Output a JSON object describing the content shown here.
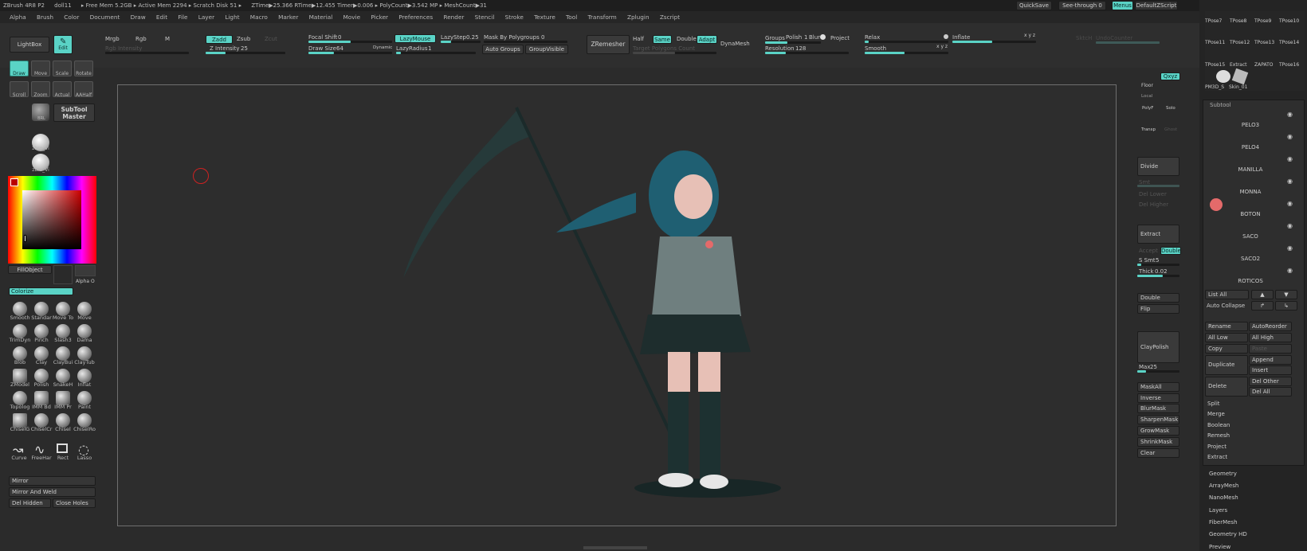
{
  "titlebar": {
    "items": [
      "ZBrush 4R8 P2",
      "doll11",
      "▸ Free Mem 5.2GB ▸ Active Mem 2294 ▸ Scratch Disk 51 ▸",
      "ZTime▶25.366 RTime▶12.455 Timer▶0.006 ▸ PolyCount▶3.542 MP ▸ MeshCount▶31"
    ],
    "quicksave": "QuickSave",
    "seethrough": "See-through",
    "seethrough_value": "0",
    "menus": "Menus",
    "defaultzscript": "DefaultZScript"
  },
  "menubar": [
    "Alpha",
    "Brush",
    "Color",
    "Document",
    "Draw",
    "Edit",
    "File",
    "Layer",
    "Light",
    "Macro",
    "Marker",
    "Material",
    "Movie",
    "Picker",
    "Preferences",
    "Render",
    "Stencil",
    "Stroke",
    "Texture",
    "Tool",
    "Transform",
    "Zplugin",
    "Zscript"
  ],
  "topshelf": {
    "lightbox": "LightBox",
    "edit": "Edit",
    "mrgb": "Mrgb",
    "rgb": "Rgb",
    "m": "M",
    "rgb_intensity": "Rgb Intensity",
    "zadd": "Zadd",
    "zsub": "Zsub",
    "zcut": "Zcut",
    "z_intensity_label": "Z Intensity",
    "z_intensity_value": "25",
    "focal_shift_label": "Focal Shift",
    "focal_shift_value": "0",
    "draw_size_label": "Draw Size",
    "draw_size_value": "64",
    "dynamic": "Dynamic",
    "lazymouse": "LazyMouse",
    "lazystep_label": "LazyStep",
    "lazystep_value": "0.25",
    "lazyradius_label": "LazyRadius",
    "lazyradius_value": "1",
    "mask_by_polygroups_label": "Mask By Polygroups",
    "mask_by_polygroups_value": "0",
    "auto_groups": "Auto Groups",
    "groupvisible": "GroupVisible",
    "zremesher": "ZRemesher",
    "half": "Half",
    "same": "Same",
    "double": "Double",
    "adapt": "Adapt",
    "target_polygons_count": "Target Polygons Count",
    "dynamesh": "DynaMesh",
    "groups": "Groups",
    "polish_label": "Polish",
    "polish_value": "1",
    "blur": "Blur",
    "project": "Project",
    "resolution_label": "Resolution",
    "resolution_value": "128",
    "relax": "Relax",
    "inflate": "Inflate",
    "smooth": "Smooth",
    "sketch": "SktcH",
    "undocounter": "UndoCounter"
  },
  "leftpanel": {
    "tools": [
      {
        "label": "Draw",
        "active": true
      },
      {
        "label": "Move"
      },
      {
        "label": "Scale"
      },
      {
        "label": "Rotate"
      },
      {
        "label": "Scroll"
      },
      {
        "label": "Zoom"
      },
      {
        "label": "Actual"
      },
      {
        "label": "AAHalf"
      }
    ],
    "brl": "BRL",
    "subtool_master": "SubTool Master",
    "material_labels": [
      "zbro_Vi",
      "zbro_Vi"
    ],
    "fill_object": "FillObject",
    "alpha_off": "Alpha O",
    "colorize": "Colorize",
    "brushes": [
      "Smooth",
      "Standar",
      "Move To",
      "Move",
      "TrimDyn",
      "Pinch",
      "Slash3",
      "Dama",
      "Blob",
      "Clay",
      "ClayBui",
      "ClayTub",
      "ZModel",
      "Polish",
      "SnakeH",
      "Inflat",
      "Topolog",
      "IMM Bd",
      "IMM Pr",
      "Paint",
      "ChiselG",
      "ChiselCr",
      "Chisel",
      "ChiselRo"
    ],
    "strokes": [
      "Curve",
      "FreeHar",
      "Rect",
      "Lasso"
    ],
    "mirror": "Mirror",
    "mirror_and_weld": "Mirror And Weld",
    "del_hidden": "Del Hidden",
    "close_holes": "Close Holes"
  },
  "rightshelf": {
    "floor": "Floor",
    "xyz": "Qxyz",
    "local": "Local",
    "polyf": "PolyF",
    "solo": "Solo",
    "transp": "Transp",
    "ghost": "Ghost",
    "divide": "Divide",
    "smt": "Smt",
    "del_lower": "Del Lower",
    "del_higher": "Del Higher",
    "extract": "Extract",
    "accept": "Accept",
    "double": "Double",
    "s_smt_label": "S Smt",
    "s_smt_value": "5",
    "thick_label": "Thick",
    "thick_value": "0.02",
    "double2": "Double",
    "flip": "Flip",
    "claypolish": "ClayPolish",
    "max_label": "Max",
    "max_value": "25",
    "mask_buttons": [
      "MaskAll",
      "Inverse",
      "BlurMask",
      "SharpenMask",
      "GrowMask",
      "ShrinkMask",
      "Clear"
    ]
  },
  "tray": {
    "thumb_labels_row1": [
      "TPose7",
      "TPose8",
      "TPose9",
      "TPose10"
    ],
    "thumb_labels_row2": [
      "TPose11",
      "TPose12",
      "TPose13",
      "TPose14"
    ],
    "thumb_labels_row3": [
      "TPose15",
      "Extract",
      "ZAPATO",
      "TPose16"
    ],
    "pm3d": "PM3D_S",
    "skin": "Skin_01",
    "subtool_header": "Subtool",
    "subtools": [
      "PELO3",
      "PELO4",
      "MANILLA",
      "MONNA",
      "BOTON",
      "SACO",
      "SACO2",
      "ROTICOS"
    ],
    "list_all": "List All",
    "auto_collapse": "Auto Collapse",
    "rename": "Rename",
    "autoreorder": "AutoReorder",
    "all_low": "All Low",
    "all_high": "All High",
    "copy": "Copy",
    "paste": "Paste",
    "duplicate": "Duplicate",
    "append": "Append",
    "insert": "Insert",
    "delete": "Delete",
    "del_other": "Del Other",
    "del_all": "Del All",
    "subtool_actions": [
      "Split",
      "Merge",
      "Boolean",
      "Remesh",
      "Project",
      "Extract"
    ],
    "sections": [
      "Geometry",
      "ArrayMesh",
      "NanoMesh",
      "Layers",
      "FiberMesh",
      "Geometry HD",
      "Preview"
    ]
  },
  "colors": {
    "accent": "#5ad3c6",
    "bg": "#2b2b2b",
    "panel": "#242424"
  }
}
